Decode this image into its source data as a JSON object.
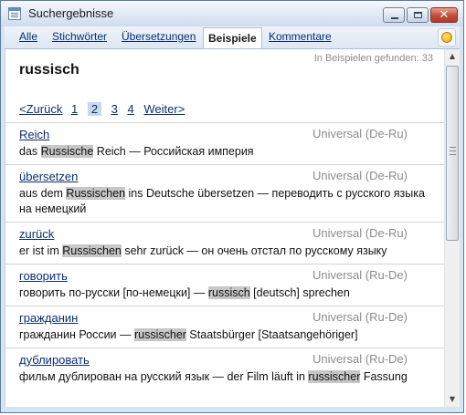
{
  "window": {
    "title": "Suchergebnisse",
    "icon": "dictionary-app-icon"
  },
  "tabs": [
    {
      "label": "Alle",
      "active": false
    },
    {
      "label": "Stichwörter",
      "active": false
    },
    {
      "label": "Übersetzungen",
      "active": false
    },
    {
      "label": "Beispiele",
      "active": true
    },
    {
      "label": "Kommentare",
      "active": false
    }
  ],
  "search": {
    "word": "russisch",
    "found_text": "In Beispielen gefunden: 33"
  },
  "pager": {
    "prev": "<Zurück",
    "pages": [
      "1",
      "2",
      "3",
      "4"
    ],
    "current": "2",
    "next": "Weiter>"
  },
  "entries": [
    {
      "headword": "Reich",
      "source": "Universal (De-Ru)",
      "example": [
        {
          "t": "das "
        },
        {
          "t": "Russische",
          "hl": true
        },
        {
          "t": " Reich — Российская империя"
        }
      ]
    },
    {
      "headword": "übersetzen",
      "source": "Universal (De-Ru)",
      "example": [
        {
          "t": "aus dem "
        },
        {
          "t": "Russischen",
          "hl": true
        },
        {
          "t": " ins Deutsche übersetzen — переводить с русского языка на немецкий"
        }
      ]
    },
    {
      "headword": "zurück",
      "source": "Universal (De-Ru)",
      "example": [
        {
          "t": "er ist im "
        },
        {
          "t": "Russischen",
          "hl": true
        },
        {
          "t": " sehr zurück — он очень отстал по русскому языку"
        }
      ]
    },
    {
      "headword": "говорить",
      "source": "Universal (Ru-De)",
      "example": [
        {
          "t": "говорить по-русски [по-немецки] — "
        },
        {
          "t": "russisch",
          "hl": true
        },
        {
          "t": " [deutsch] sprechen"
        }
      ]
    },
    {
      "headword": "гражданин",
      "source": "Universal (Ru-De)",
      "example": [
        {
          "t": "гражданин России — "
        },
        {
          "t": "russischer",
          "hl": true
        },
        {
          "t": " Staatsbürger [Staatsangehöriger]"
        }
      ]
    },
    {
      "headword": "дублировать",
      "source": "Universal (Ru-De)",
      "example": [
        {
          "t": "фильм дублирован на русский язык — der Film läuft in "
        },
        {
          "t": "russischer",
          "hl": true
        },
        {
          "t": " Fassung"
        }
      ]
    }
  ],
  "colors": {
    "accent": "#0b2e6e",
    "highlight": "#c7c7c7",
    "active_page": "#c6d8ee"
  }
}
